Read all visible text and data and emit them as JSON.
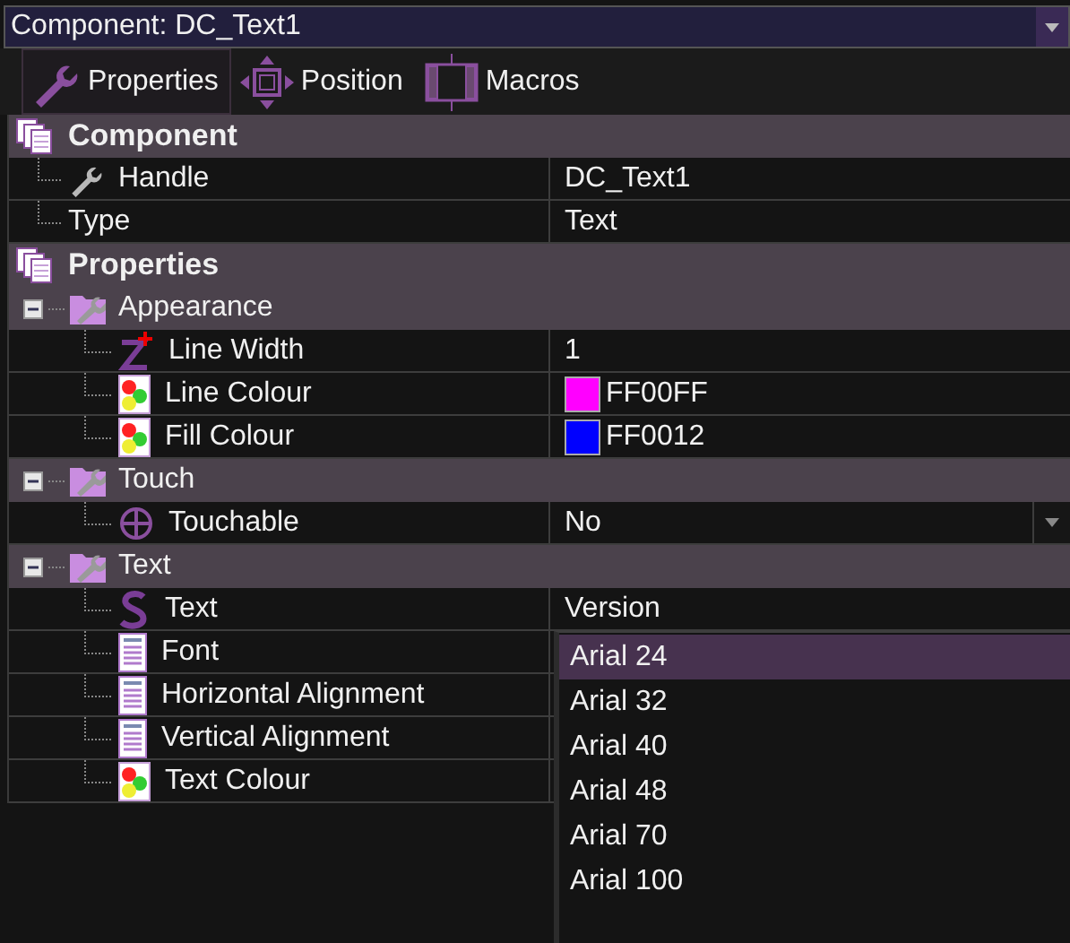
{
  "component_selector": {
    "label": "Component: DC_Text1"
  },
  "tabs": [
    {
      "label": "Properties",
      "kind": "wrench",
      "selected": true
    },
    {
      "label": "Position",
      "kind": "move",
      "selected": false
    },
    {
      "label": "Macros",
      "kind": "macro",
      "selected": false
    }
  ],
  "sections": [
    {
      "title": "Component",
      "rows": [
        {
          "label": "Handle",
          "kind": "handle",
          "value": "DC_Text1"
        },
        {
          "label": "Type",
          "kind": "plain",
          "value": "Text"
        }
      ]
    },
    {
      "title": "Properties",
      "groups": [
        {
          "title": "Appearance",
          "expanded": true,
          "rows": [
            {
              "label": "Line Width",
              "kind": "number",
              "value": "1"
            },
            {
              "label": "Line Colour",
              "kind": "color",
              "value": "FF00FF",
              "color": "#ff00ff"
            },
            {
              "label": "Fill Colour",
              "kind": "color",
              "value": "FF0012",
              "color": "#0000ff"
            }
          ]
        },
        {
          "title": "Touch",
          "expanded": true,
          "rows": [
            {
              "label": "Touchable",
              "kind": "toggle",
              "value": "No"
            }
          ]
        },
        {
          "title": "Text",
          "expanded": true,
          "rows": [
            {
              "label": "Text",
              "kind": "string",
              "value": "Version"
            },
            {
              "label": "Font",
              "kind": "option"
            },
            {
              "label": "Horizontal Alignment",
              "kind": "option"
            },
            {
              "label": "Vertical Alignment",
              "kind": "option"
            },
            {
              "label": "Text Colour",
              "kind": "color"
            }
          ]
        }
      ]
    }
  ],
  "dropdown": {
    "items": [
      {
        "label": "Arial 24",
        "selected": true
      },
      {
        "label": "Arial 32",
        "selected": false
      },
      {
        "label": "Arial 40",
        "selected": false
      },
      {
        "label": "Arial 48",
        "selected": false
      },
      {
        "label": "Arial 70",
        "selected": false
      },
      {
        "label": "Arial 100",
        "selected": false
      }
    ]
  }
}
